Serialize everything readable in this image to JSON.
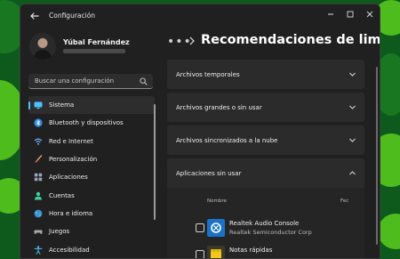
{
  "window": {
    "title": "Configuración"
  },
  "profile": {
    "name": "Yúbal Fernández"
  },
  "search": {
    "placeholder": "Buscar una configuración"
  },
  "sidebar": {
    "items": [
      {
        "label": "Sistema",
        "icon": "monitor-icon",
        "active": true
      },
      {
        "label": "Bluetooth y dispositivos",
        "icon": "bluetooth-icon"
      },
      {
        "label": "Red e Internet",
        "icon": "wifi-icon"
      },
      {
        "label": "Personalización",
        "icon": "brush-icon"
      },
      {
        "label": "Aplicaciones",
        "icon": "apps-icon"
      },
      {
        "label": "Cuentas",
        "icon": "person-icon"
      },
      {
        "label": "Hora e idioma",
        "icon": "globe-icon"
      },
      {
        "label": "Juegos",
        "icon": "gamepad-icon"
      },
      {
        "label": "Accesibilidad",
        "icon": "accessibility-icon"
      }
    ]
  },
  "header": {
    "title": "Recomendaciones de limpieza"
  },
  "sections": [
    {
      "label": "Archivos temporales",
      "expanded": false
    },
    {
      "label": "Archivos grandes o sin usar",
      "expanded": false
    },
    {
      "label": "Archivos sincronizados a la nube",
      "expanded": false
    },
    {
      "label": "Aplicaciones sin usar",
      "expanded": true
    }
  ],
  "unused_apps": {
    "columns": {
      "name": "Nombre",
      "date": "Fec"
    },
    "rows": [
      {
        "name": "Realtek Audio Console",
        "publisher": "Realtek Semiconductor Corp",
        "icon": "realtek-app-icon"
      },
      {
        "name": "Notas rápidas",
        "publisher": "",
        "icon": "sticky-notes-icon"
      }
    ]
  },
  "colors": {
    "accent": "#4cc2ff",
    "window_bg": "#202020",
    "card_bg": "#2b2b2b",
    "wallpaper_green": "#55c61e"
  }
}
